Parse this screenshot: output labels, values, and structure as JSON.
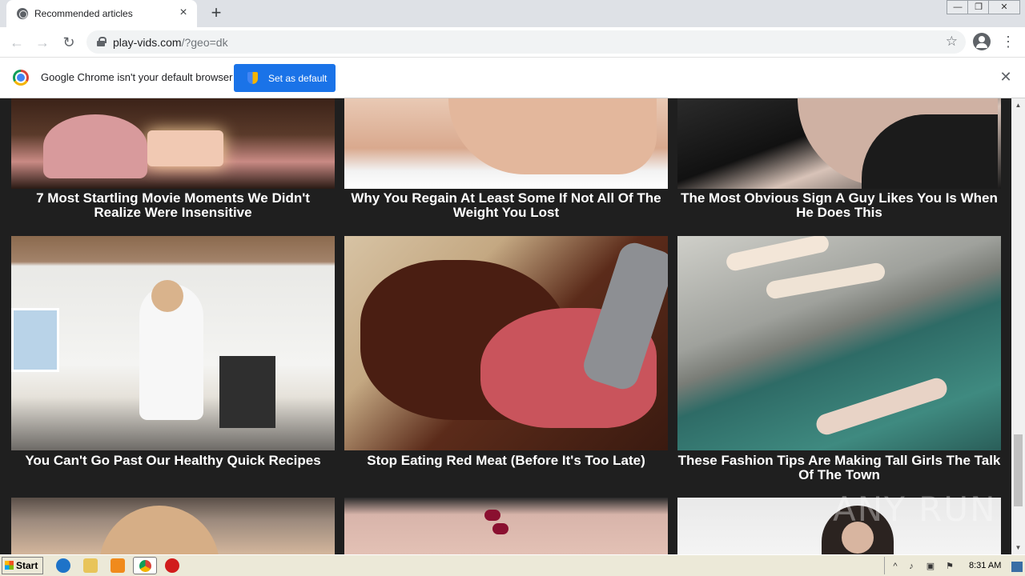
{
  "browser": {
    "tab_title": "Recommended articles",
    "tab_close": "×",
    "new_tab": "+",
    "url_host": "play-vids.com",
    "url_path": "/?geo=dk",
    "back": "←",
    "forward": "→",
    "reload": "↻",
    "bookmark_star": "☆",
    "menu": "⋮",
    "window_min": "—",
    "window_max": "❐",
    "window_close": "✕"
  },
  "infobar": {
    "message": "Google Chrome isn't your default browser",
    "button_label": "Set as default",
    "close": "✕"
  },
  "articles": [
    {
      "caption": "7 Most Startling Movie Moments We Didn't Realize Were Insensitive",
      "icon": "birthday-cake-photo"
    },
    {
      "caption": "Why You Regain At Least Some If Not All Of The Weight You Lost",
      "icon": "body-photo"
    },
    {
      "caption": "The Most Obvious Sign A Guy Likes You Is When He Does This",
      "icon": "couple-photo"
    },
    {
      "caption": "You Can't Go Past Our Healthy Quick Recipes",
      "icon": "kitchen-photo"
    },
    {
      "caption": "Stop Eating Red Meat (Before It's Too Late)",
      "icon": "steak-photo"
    },
    {
      "caption": "These Fashion Tips Are Making Tall Girls The Talk Of The Town",
      "icon": "fountain-photo"
    },
    {
      "caption": "",
      "icon": "woman-portrait-photo"
    },
    {
      "caption": "",
      "icon": "hands-photo"
    },
    {
      "caption": "",
      "icon": "woman-photo"
    }
  ],
  "watermark": "ANY RUN",
  "taskbar": {
    "start_label": "Start",
    "clock": "8:31 AM"
  },
  "colors": {
    "page_background": "#1f1f1f",
    "infobar_button": "#1a73e8",
    "caption_text": "#ffffff"
  }
}
